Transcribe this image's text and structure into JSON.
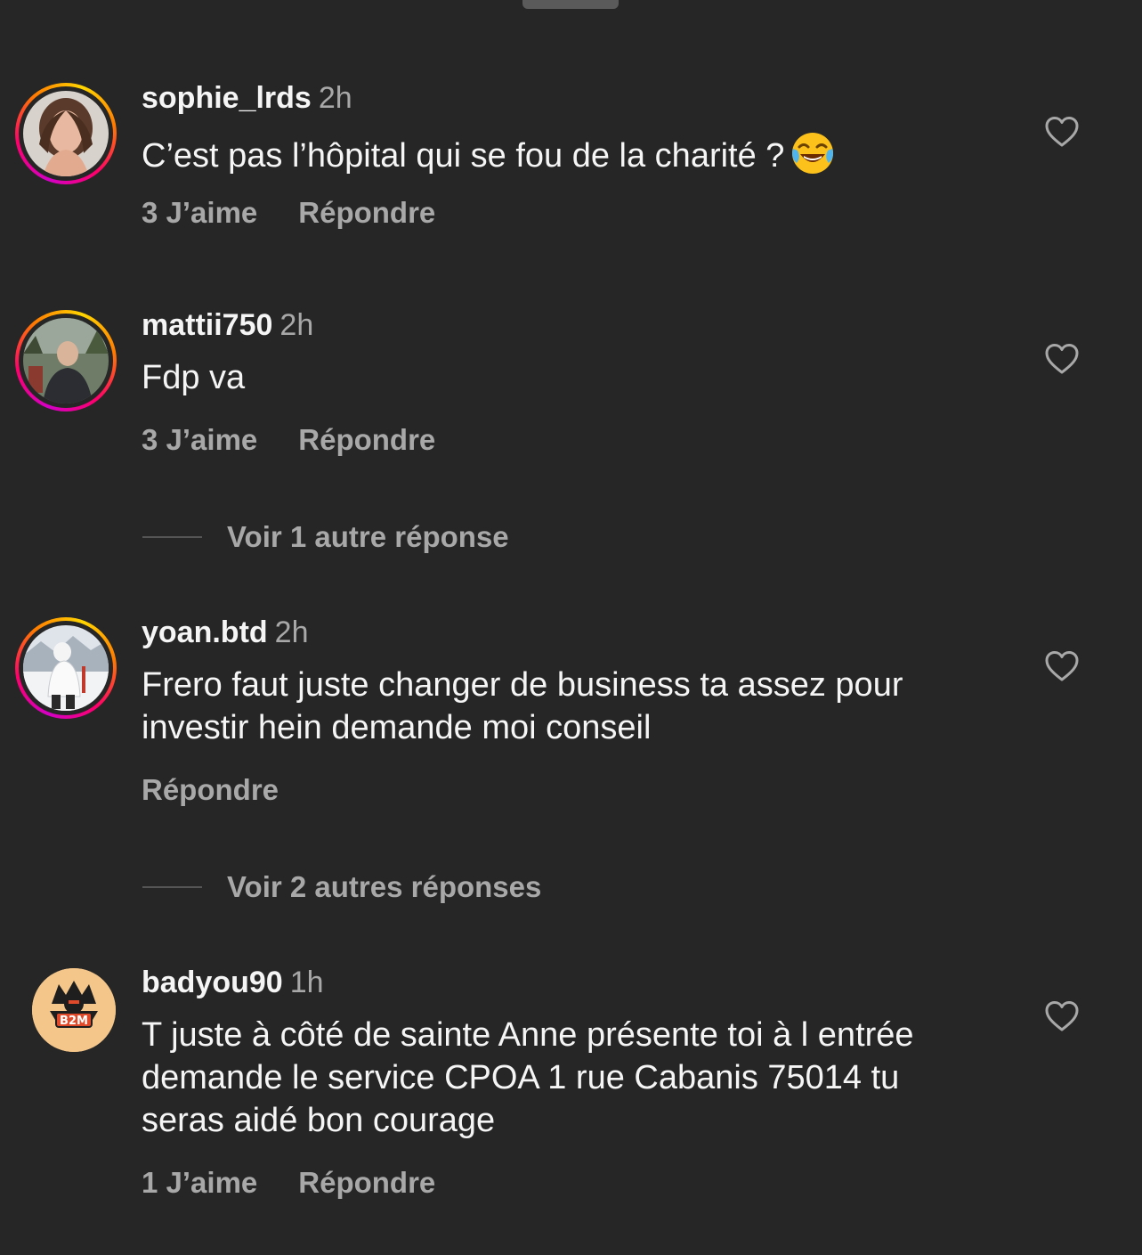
{
  "comments": [
    {
      "username": "sophie_lrds",
      "time": "2h",
      "text": "C’est pas l’hôpital qui se fou de la charité ?",
      "emoji": "face-with-tears-of-joy",
      "likes_label": "3 J’aime",
      "reply_label": "Répondre"
    },
    {
      "username": "mattii750",
      "time": "2h",
      "text": "Fdp va",
      "likes_label": "3 J’aime",
      "reply_label": "Répondre",
      "view_replies_label": "Voir 1 autre réponse"
    },
    {
      "username": "yoan.btd",
      "time": "2h",
      "text": "Frero faut juste changer de business ta assez pour investir hein demande moi conseil",
      "reply_label": "Répondre",
      "view_replies_label": "Voir 2 autres réponses"
    },
    {
      "username": "badyou90",
      "time": "1h",
      "text": "T juste à côté de sainte Anne présente toi à l entrée demande le service CPOA 1 rue Cabanis 75014 tu seras aidé bon courage",
      "likes_label": "1 J’aime",
      "reply_label": "Répondre",
      "avatar_logo_text": "B2M"
    }
  ],
  "icons": {
    "like": "heart-outline-icon",
    "handle": "drag-handle"
  },
  "colors": {
    "background": "#262626",
    "primary_text": "#f5f5f5",
    "secondary_text": "#a8a8a8",
    "story_ring_start": "#d300c5",
    "story_ring_end": "#ffd600",
    "avatar_badge_bg": "#f5c68a"
  }
}
